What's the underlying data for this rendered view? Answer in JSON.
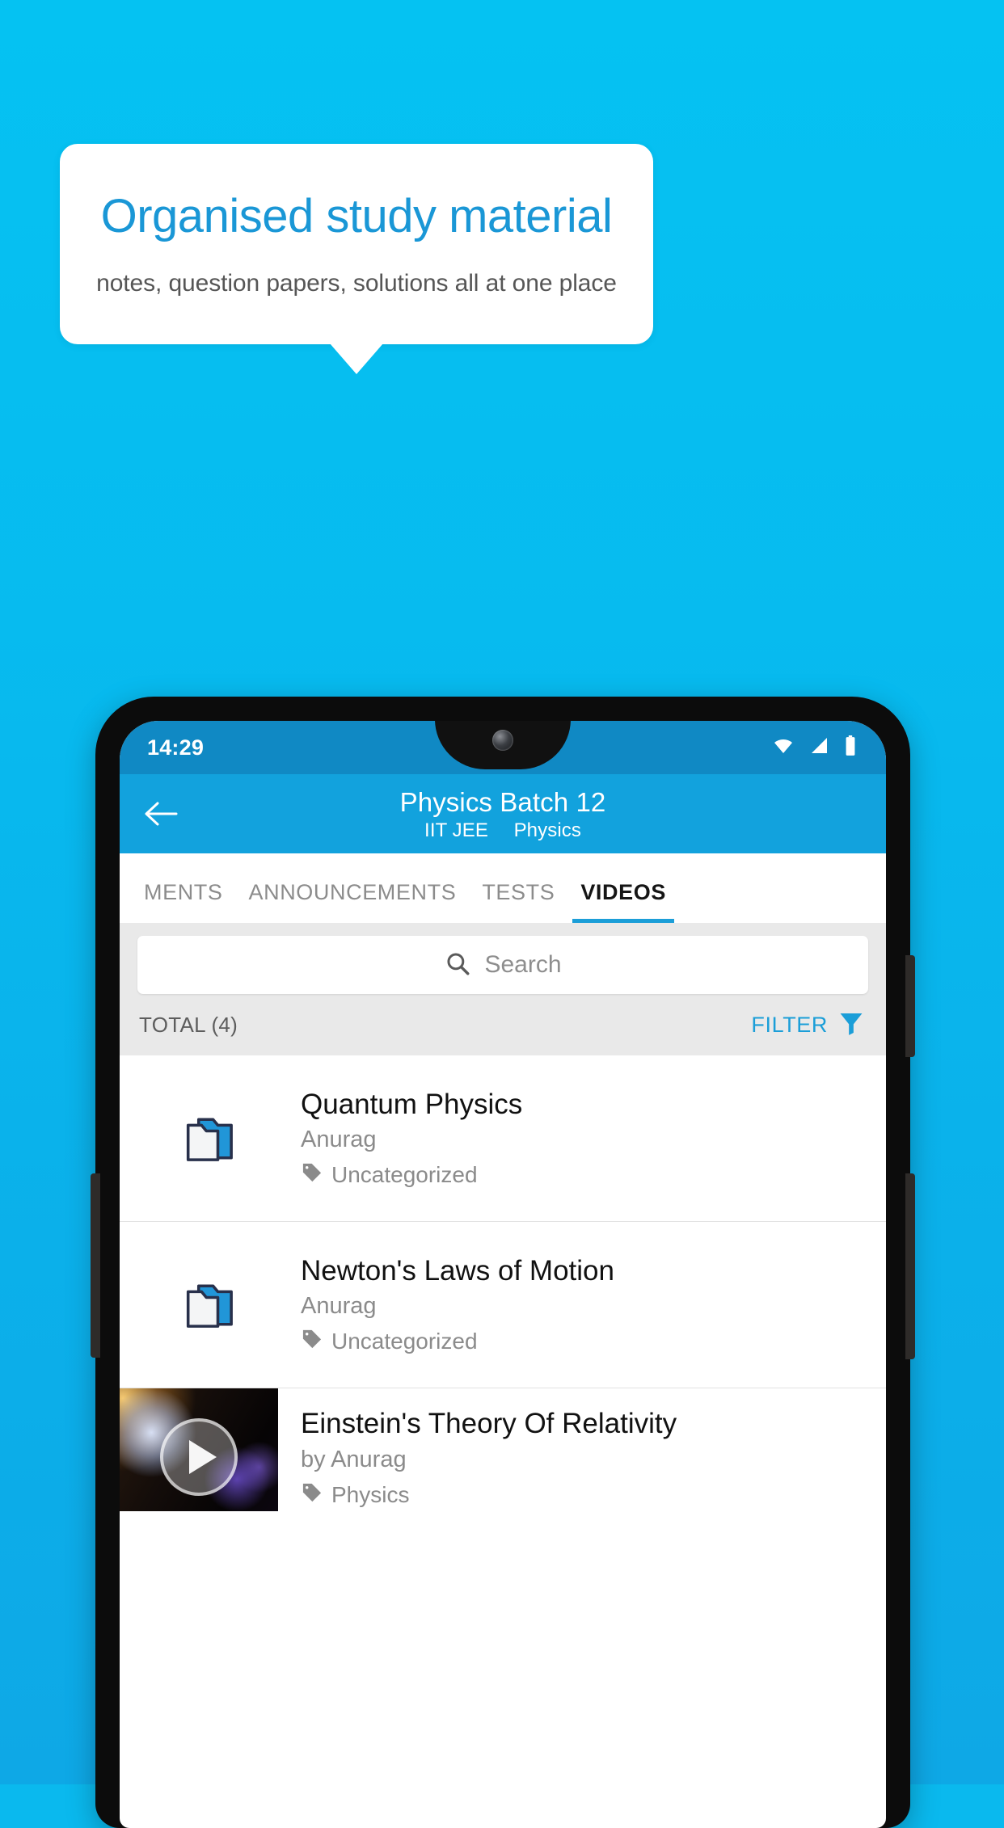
{
  "promo": {
    "headline": "Organised study material",
    "subhead": "notes, question papers, solutions all at one place",
    "headline_color": "#1a97d6",
    "background_color": "#0ab9ee"
  },
  "phone": {
    "statusbar": {
      "time": "14:29",
      "icons": [
        "wifi-icon",
        "signal-icon",
        "battery-icon"
      ]
    },
    "appbar": {
      "back": "back-arrow-icon",
      "title": "Physics Batch 12",
      "subtitle_exam": "IIT JEE",
      "subtitle_subject": "Physics",
      "color": "#12a2dd"
    },
    "tabs": [
      {
        "label": "MENTS",
        "active": false
      },
      {
        "label": "ANNOUNCEMENTS",
        "active": false
      },
      {
        "label": "TESTS",
        "active": false
      },
      {
        "label": "VIDEOS",
        "active": true
      }
    ],
    "search": {
      "placeholder": "Search",
      "icon": "search-icon"
    },
    "list_header": {
      "total": "TOTAL (4)",
      "filter_label": "FILTER",
      "filter_icon": "funnel-icon",
      "accent_color": "#1b9ed8"
    },
    "items": [
      {
        "icon": "folder-icon",
        "title": "Quantum Physics",
        "author": "Anurag",
        "tag": "Uncategorized",
        "tag_icon": "tag-icon"
      },
      {
        "icon": "folder-icon",
        "title": "Newton's Laws of Motion",
        "author": "Anurag",
        "tag": "Uncategorized",
        "tag_icon": "tag-icon"
      },
      {
        "icon": "video-thumbnail",
        "title": "Einstein's Theory Of Relativity",
        "author": "by Anurag",
        "tag": "Physics",
        "tag_icon": "tag-icon",
        "play_icon": "play-icon"
      }
    ]
  }
}
